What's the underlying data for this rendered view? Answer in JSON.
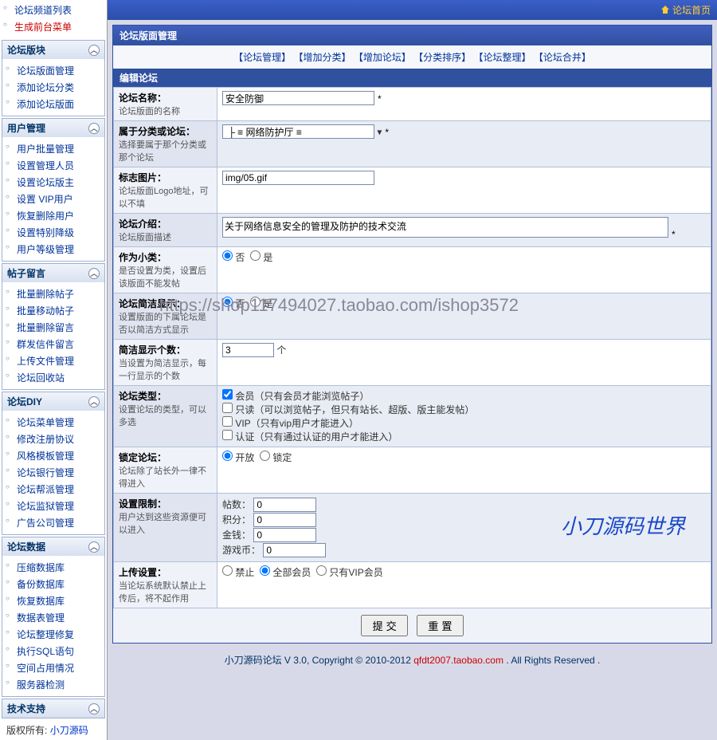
{
  "topbar": {
    "home": "论坛首页"
  },
  "sidebar": {
    "top_items": [
      "论坛频道列表",
      "生成前台菜单"
    ],
    "groups": [
      {
        "title": "论坛版块",
        "items": [
          "论坛版面管理",
          "添加论坛分类",
          "添加论坛版面"
        ]
      },
      {
        "title": "用户管理",
        "items": [
          "用户批量管理",
          "设置管理人员",
          "设置论坛版主",
          "设置 VIP用户",
          "恢复删除用户",
          "设置特别降级",
          "用户等级管理"
        ]
      },
      {
        "title": "帖子留言",
        "items": [
          "批量删除帖子",
          "批量移动帖子",
          "批量删除留言",
          "群发信件留言",
          "上传文件管理",
          "论坛回收站"
        ]
      },
      {
        "title": "论坛DIY",
        "items": [
          "论坛菜单管理",
          "修改注册协议",
          "风格模板管理",
          "论坛银行管理",
          "论坛帮派管理",
          "论坛监狱管理",
          "广告公司管理"
        ]
      },
      {
        "title": "论坛数据",
        "items": [
          "压缩数据库",
          "备份数据库",
          "恢复数据库",
          "数据表管理",
          "论坛整理修复",
          "执行SQL语句",
          "空间占用情况",
          "服务器检测"
        ]
      },
      {
        "title": "技术支持",
        "items": []
      }
    ],
    "copyright_label": "版权所有:",
    "copyright_value": "小刀源码"
  },
  "panel": {
    "title": "论坛版面管理",
    "tabs": [
      "【论坛管理】",
      "【增加分类】",
      "【增加论坛】",
      "【分类排序】",
      "【论坛整理】",
      "【论坛合并】"
    ],
    "section": "编辑论坛"
  },
  "form": {
    "name": {
      "label": "论坛名称：",
      "sub": "论坛版面的名称",
      "value": "安全防御"
    },
    "parent": {
      "label": "属于分类或论坛：",
      "sub": "选择要属于那个分类或那个论坛",
      "value": " ├ ≡ 网络防护厅 ≡"
    },
    "logo": {
      "label": "标志图片：",
      "sub": "论坛版面Logo地址，可以不填",
      "value": "img/05.gif"
    },
    "intro": {
      "label": "论坛介绍：",
      "sub": "论坛版面描述",
      "value": "关于网络信息安全的管理及防护的技术交流"
    },
    "asclass": {
      "label": "作为小类：",
      "sub": "是否设置为类，设置后该版面不能发帖",
      "opts": [
        "否",
        "是"
      ],
      "sel": 0
    },
    "simple": {
      "label": "论坛简洁显示：",
      "sub": "设置版面的下属论坛是否以简洁方式显示",
      "opts": [
        "否",
        "是"
      ],
      "sel": 0
    },
    "simplenum": {
      "label": "简洁显示个数：",
      "sub": "当设置为简洁显示，每一行显示的个数",
      "value": "3",
      "unit": "个"
    },
    "type": {
      "label": "论坛类型：",
      "sub": "设置论坛的类型，可以多选",
      "opts": [
        "会员（只有会员才能浏览帖子）",
        "只读（可以浏览帖子，但只有站长、超版、版主能发帖）",
        "VIP（只有vip用户才能进入）",
        "认证（只有通过认证的用户才能进入）"
      ],
      "checked": [
        true,
        false,
        false,
        false
      ]
    },
    "lock": {
      "label": "锁定论坛：",
      "sub": "论坛除了站长外一律不得进入",
      "opts": [
        "开放",
        "锁定"
      ],
      "sel": 0
    },
    "limit": {
      "label": "设置限制：",
      "sub": "用户达到这些资源便可以进入",
      "rows": [
        {
          "name": "帖数：",
          "value": "0"
        },
        {
          "name": "积分：",
          "value": "0"
        },
        {
          "name": "金钱：",
          "value": "0"
        },
        {
          "name": "游戏币：",
          "value": "0"
        }
      ]
    },
    "upload": {
      "label": "上传设置：",
      "sub": "当论坛系统默认禁止上传后，将不起作用",
      "opts": [
        "禁止",
        "全部会员",
        "只有VIP会员"
      ],
      "sel": 1
    },
    "submit": "提 交",
    "reset": "重 置"
  },
  "footer": {
    "prefix": "小刀源码论坛  V 3.0, Copyright © 2010-2012 ",
    "link": "qfdt2007.taobao.com",
    "suffix": ". All Rights Reserved ."
  },
  "watermark": "小刀源码世界",
  "urlmark": "https://shop117494027.taobao.com/ishop3572"
}
